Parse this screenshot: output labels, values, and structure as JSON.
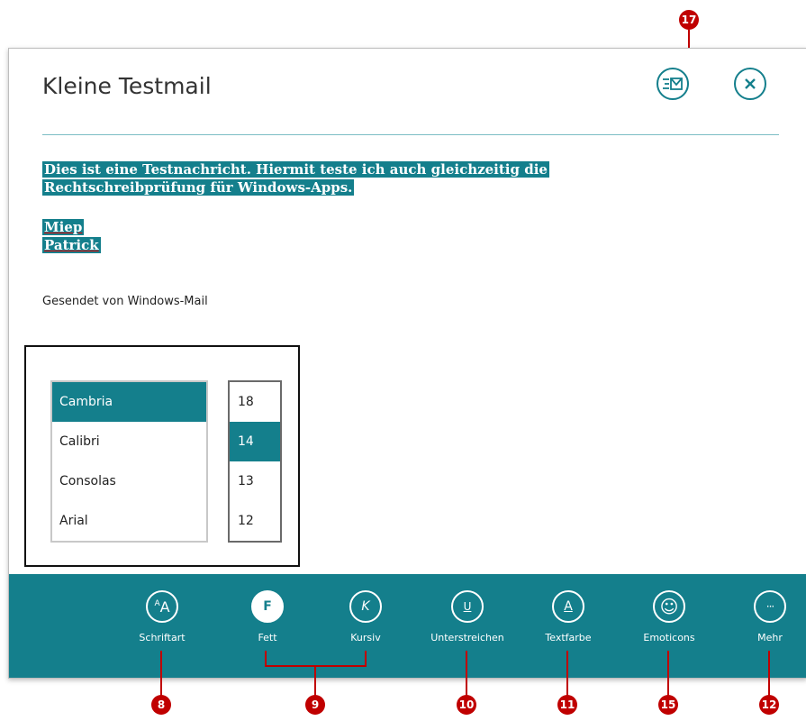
{
  "mail": {
    "title": "Kleine Testmail",
    "body_line1": "Dies ist eine Testnachricht. Hiermit teste  ich auch gleichzeitig die",
    "body_line2": "Rechtschreibprüfung für Windows-Apps.",
    "signature_line1": "Miep",
    "signature_line2": "Patrick",
    "sent_from": "Gesendet von Windows-Mail"
  },
  "header": {
    "send_icon": "send-mail-icon",
    "close_icon": "close-icon"
  },
  "font_picker": {
    "fonts": [
      "Cambria",
      "Calibri",
      "Consolas",
      "Arial"
    ],
    "selected_font": "Cambria",
    "sizes": [
      "18",
      "14",
      "13",
      "12"
    ],
    "selected_size": "14"
  },
  "appbar": {
    "buttons": [
      {
        "label": "Schriftart",
        "glyph": "AA",
        "icon": "font-icon"
      },
      {
        "label": "Fett",
        "glyph": "F",
        "icon": "bold-icon"
      },
      {
        "label": "Kursiv",
        "glyph": "K",
        "icon": "italic-icon"
      },
      {
        "label": "Unterstreichen",
        "glyph": "U",
        "icon": "underline-icon"
      },
      {
        "label": "Textfarbe",
        "glyph": "A",
        "icon": "text-color-icon"
      },
      {
        "label": "Emoticons",
        "glyph": "☺",
        "icon": "emoticon-icon"
      },
      {
        "label": "Mehr",
        "glyph": "···",
        "icon": "more-icon"
      }
    ]
  },
  "callouts": {
    "send": "17",
    "font": "8",
    "bold_italic": "9",
    "underline": "10",
    "text_color": "11",
    "emoticons": "15",
    "more": "12"
  },
  "colors": {
    "accent": "#147f8c",
    "callout": "#c00000"
  }
}
